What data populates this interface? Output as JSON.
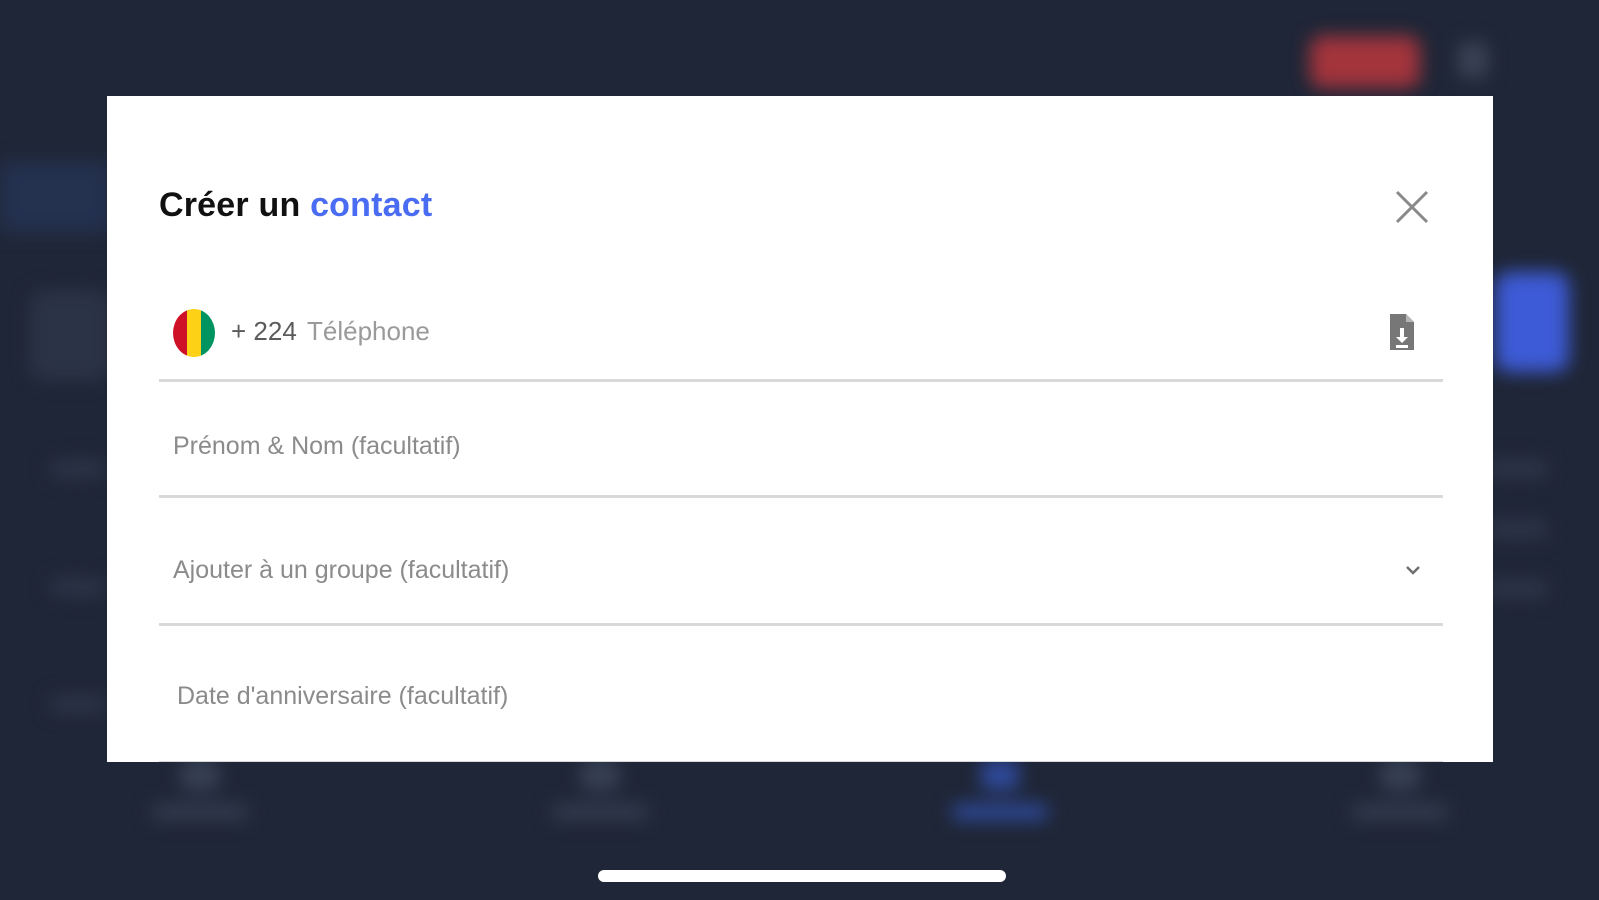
{
  "modal": {
    "title_prefix": "Créer un",
    "title_accent": "contact",
    "close_icon": "close-icon"
  },
  "phone": {
    "flag": "guinea-flag",
    "flag_colors": [
      "#ce1126",
      "#fcd116",
      "#009460"
    ],
    "dial_code": "+ 224",
    "placeholder": "Téléphone",
    "import_icon": "contact-file-icon"
  },
  "name": {
    "placeholder": "Prénom & Nom (facultatif)"
  },
  "group": {
    "placeholder": "Ajouter à un groupe (facultatif)",
    "icon": "chevron-down-icon"
  },
  "birthday": {
    "placeholder": "Date d'anniversaire (facultatif)"
  },
  "colors": {
    "accent": "#4a6cf3",
    "background": "#1f2637"
  }
}
